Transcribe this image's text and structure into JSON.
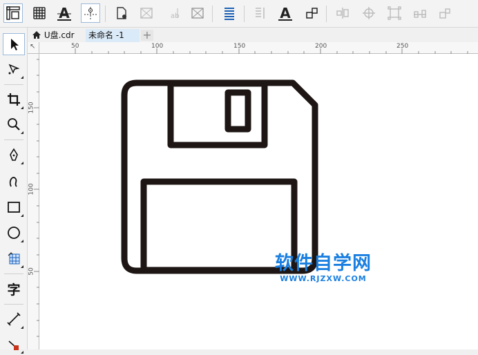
{
  "toolbar": {
    "buttons": [
      {
        "icon": "ruler-options-icon",
        "active": true
      },
      {
        "icon": "grid-icon",
        "active": false
      },
      {
        "icon": "text-properties-icon",
        "active": false
      },
      {
        "icon": "guidelines-icon",
        "active": true
      },
      {
        "icon": "object-properties-icon",
        "active": false
      },
      {
        "icon": "bitmap-icon",
        "active": false
      },
      {
        "icon": "text-edit-disabled-icon",
        "active": false
      },
      {
        "icon": "image-adjust-icon",
        "active": false
      },
      {
        "icon": "text-align-icon",
        "active": false
      },
      {
        "icon": "column-text-icon",
        "active": false
      },
      {
        "icon": "character-format-icon",
        "active": false
      },
      {
        "icon": "object-arrange-icon",
        "active": false
      },
      {
        "icon": "align-center-icon",
        "active": false
      },
      {
        "icon": "target-align-icon",
        "active": false
      },
      {
        "icon": "group-icon",
        "active": false
      },
      {
        "icon": "distribute-icon",
        "active": false
      },
      {
        "icon": "align-bottom-icon",
        "active": false
      }
    ]
  },
  "toolbox": {
    "tools": [
      {
        "icon": "pick-tool-icon",
        "active": true
      },
      {
        "icon": "shape-tool-icon",
        "active": false
      },
      {
        "icon": "crop-tool-icon",
        "active": false
      },
      {
        "icon": "zoom-tool-icon",
        "active": false
      },
      {
        "icon": "pen-tool-icon",
        "active": false
      },
      {
        "icon": "curve-tool-icon",
        "active": false
      },
      {
        "icon": "rectangle-tool-icon",
        "active": false
      },
      {
        "icon": "ellipse-tool-icon",
        "active": false
      },
      {
        "icon": "graph-paper-tool-icon",
        "active": false
      },
      {
        "icon": "text-tool-icon",
        "active": false,
        "glyph": "字"
      },
      {
        "icon": "dimension-tool-icon",
        "active": false
      },
      {
        "icon": "connector-tool-icon",
        "active": false
      }
    ]
  },
  "tabs": [
    {
      "label": "U盘.cdr",
      "icon": "home-icon",
      "active": false
    },
    {
      "label": "未命名 -1",
      "active": true
    }
  ],
  "tab_add_label": "+",
  "rulers": {
    "top_labels": [
      "50",
      "100",
      "150",
      "200",
      "250"
    ],
    "left_labels": [
      "150",
      "100",
      "50"
    ],
    "corner_label": "↖"
  },
  "watermark": {
    "title": "软件自学网",
    "url": "WWW.RJZXW.COM",
    "color": "#1a7fe0"
  },
  "colors": {
    "stroke": "#1e1614",
    "active_border": "#9ab8d8",
    "tab_active": "#dbeaf8"
  }
}
